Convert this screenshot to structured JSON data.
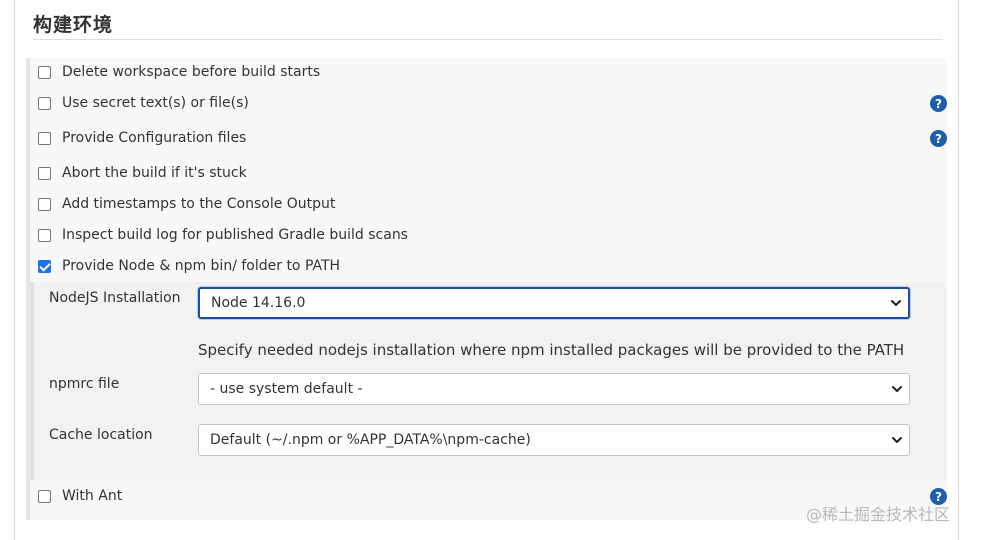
{
  "section": {
    "title": "构建环境"
  },
  "options": [
    {
      "label": "Delete workspace before build starts",
      "checked": false
    },
    {
      "label": "Use secret text(s) or file(s)",
      "checked": false
    },
    {
      "label": "Provide Configuration files",
      "checked": false
    },
    {
      "label": "Abort the build if it's stuck",
      "checked": false
    },
    {
      "label": "Add timestamps to the Console Output",
      "checked": false
    },
    {
      "label": "Inspect build log for published Gradle build scans",
      "checked": false
    },
    {
      "label": "Provide Node & npm bin/ folder to PATH",
      "checked": true
    },
    {
      "label": "With Ant",
      "checked": false
    }
  ],
  "node": {
    "installation_label": "NodeJS Installation",
    "installation_value": "Node 14.16.0",
    "installation_description": "Specify needed nodejs installation where npm installed packages will be provided to the PATH",
    "npmrc_label": "npmrc file",
    "npmrc_value": "- use system default -",
    "cache_label": "Cache location",
    "cache_value": "Default (~/.npm or %APP_DATA%\\npm-cache)"
  },
  "help_icon": {
    "glyph": "?",
    "name": "help-icon",
    "color": "#1e5ea8"
  },
  "watermark": "@稀土掘金技术社区"
}
